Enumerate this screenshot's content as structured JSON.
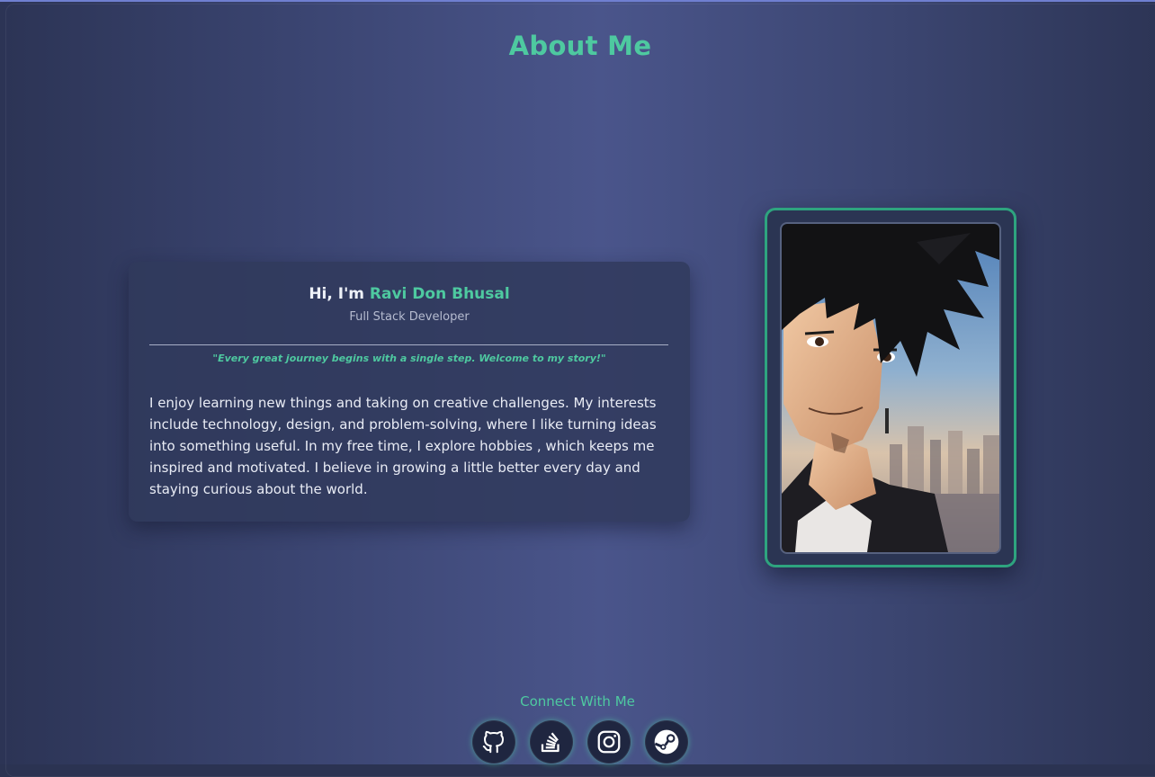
{
  "page": {
    "title": "About Me"
  },
  "intro": {
    "greeting_prefix": "Hi, I'm ",
    "name": "Ravi Don Bhusal",
    "role": "Full Stack Developer",
    "quote": "\"Every great journey begins with a single step. Welcome to my story!\"",
    "bio": "I enjoy learning new things and taking on creative challenges. My interests include technology, design, and problem-solving, where I like turning ideas into something useful. In my free time, I explore hobbies , which keeps me inspired and motivated. I believe in growing a little better every day and staying curious about the world."
  },
  "portrait": {
    "image_alt": "anime-style portrait illustration"
  },
  "connect": {
    "heading": "Connect With Me",
    "links": [
      {
        "icon": "github-icon",
        "platform": "GitHub"
      },
      {
        "icon": "stackoverflow-icon",
        "platform": "Stack Overflow"
      },
      {
        "icon": "instagram-icon",
        "platform": "Instagram"
      },
      {
        "icon": "steam-icon",
        "platform": "Steam"
      }
    ]
  },
  "colors": {
    "accent": "#4ec9a0",
    "frame_border": "#2ea47f",
    "background": "#3a4470",
    "card": "#30395c",
    "text": "#e9ecf5"
  }
}
